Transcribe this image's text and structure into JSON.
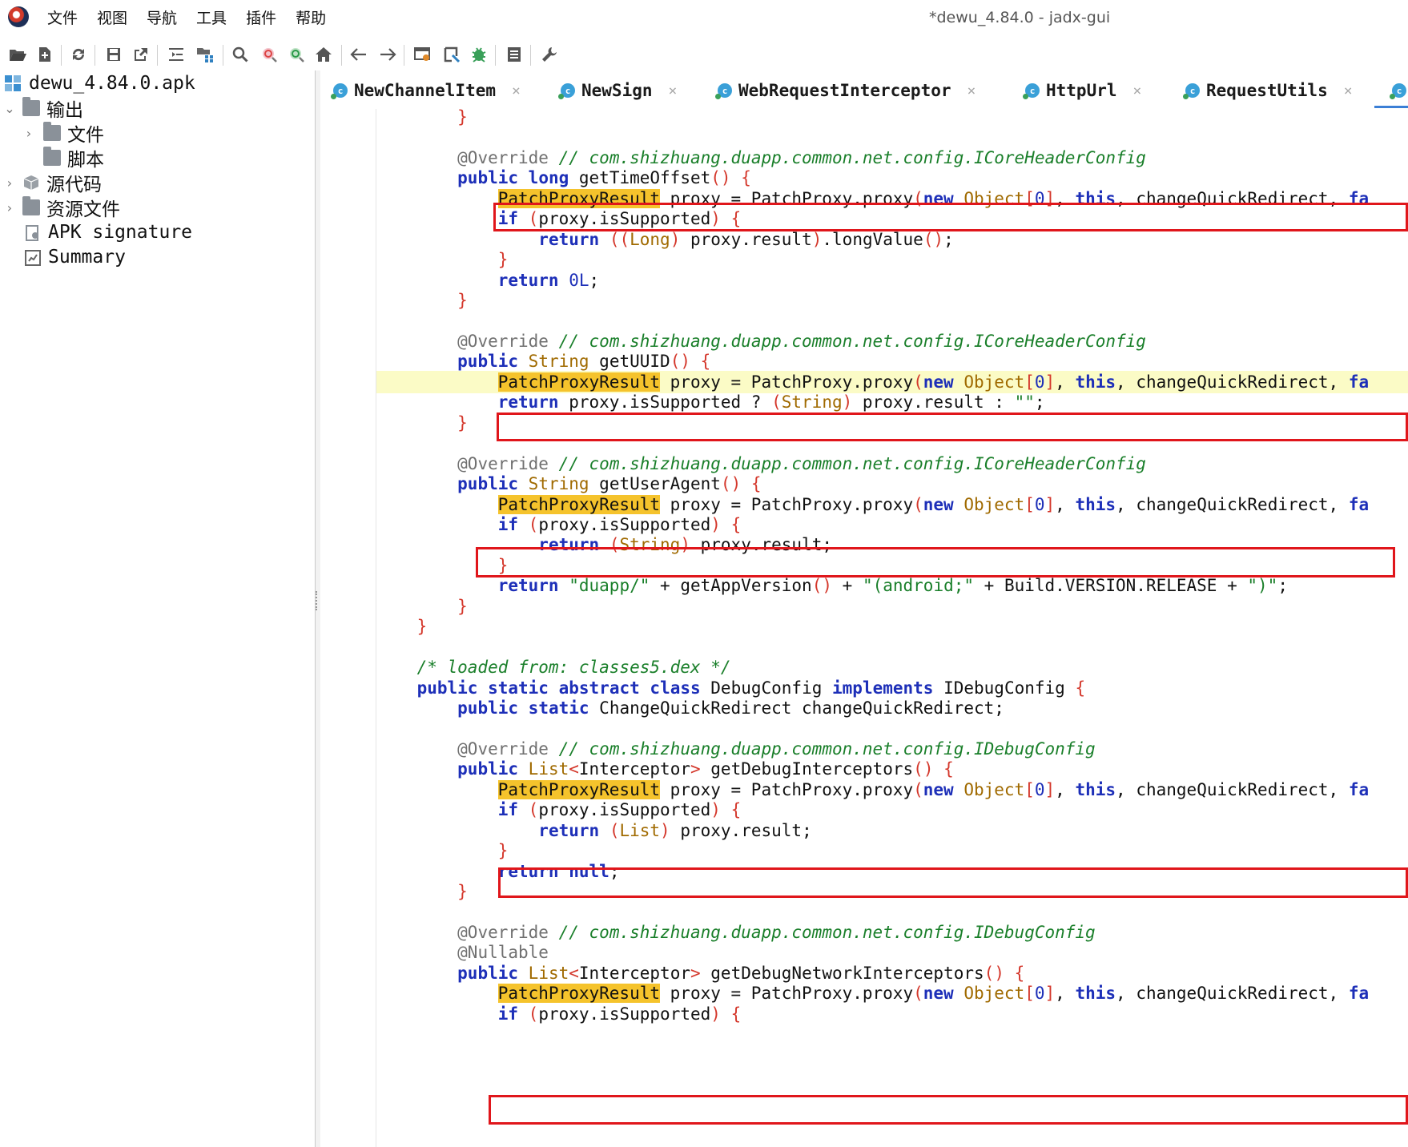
{
  "window": {
    "title": "*dewu_4.84.0 - jadx-gui",
    "menu": [
      "文件",
      "视图",
      "导航",
      "工具",
      "插件",
      "帮助"
    ]
  },
  "toolbar": {
    "icons": [
      "open-file-icon",
      "add-file-icon",
      "sync-icon",
      "save-icon",
      "export-icon",
      "text-search-icon",
      "class-tree-icon",
      "search-icon",
      "find-class-icon",
      "find-usage-icon",
      "home-icon",
      "back-icon",
      "forward-icon",
      "quick-tabs-icon",
      "deobfuscation-icon",
      "debugger-icon",
      "log-icon",
      "settings-icon"
    ]
  },
  "tree": {
    "items": [
      {
        "label": "dewu_4.84.0.apk",
        "icon": "apk-icon"
      },
      {
        "label": "输出",
        "icon": "folder-icon",
        "expanded": true
      },
      {
        "label": "文件",
        "icon": "folder-icon"
      },
      {
        "label": "脚本",
        "icon": "folder-icon"
      },
      {
        "label": "源代码",
        "icon": "package-icon"
      },
      {
        "label": "资源文件",
        "icon": "folder-icon"
      },
      {
        "label": "APK signature",
        "icon": "signature-icon"
      },
      {
        "label": "Summary",
        "icon": "summary-icon"
      }
    ]
  },
  "tabs": [
    {
      "label": "NewChannelItem"
    },
    {
      "label": "NewSign"
    },
    {
      "label": "WebRequestInterceptor"
    },
    {
      "label": "HttpUrl"
    },
    {
      "label": "RequestUtils"
    }
  ],
  "code_lines": [
    "        }",
    "",
    "        @Override // com.shizhuang.duapp.common.net.config.ICoreHeaderConfig",
    "        public long getTimeOffset() {",
    "            PatchProxyResult proxy = PatchProxy.proxy(new Object[0], this, changeQuickRedirect, fa",
    "            if (proxy.isSupported) {",
    "                return ((Long) proxy.result).longValue();",
    "            }",
    "            return 0L;",
    "        }",
    "",
    "        @Override // com.shizhuang.duapp.common.net.config.ICoreHeaderConfig",
    "        public String getUUID() {",
    "            PatchProxyResult proxy = PatchProxy.proxy(new Object[0], this, changeQuickRedirect, fa",
    "            return proxy.isSupported ? (String) proxy.result : \"\";",
    "        }",
    "",
    "        @Override // com.shizhuang.duapp.common.net.config.ICoreHeaderConfig",
    "        public String getUserAgent() {",
    "            PatchProxyResult proxy = PatchProxy.proxy(new Object[0], this, changeQuickRedirect, fa",
    "            if (proxy.isSupported) {",
    "                return (String) proxy.result;",
    "            }",
    "            return \"duapp/\" + getAppVersion() + \"(android;\" + Build.VERSION.RELEASE + \")\";",
    "        }",
    "    }",
    "",
    "    /* loaded from: classes5.dex */",
    "    public static abstract class DebugConfig implements IDebugConfig {",
    "        public static ChangeQuickRedirect changeQuickRedirect;",
    "",
    "        @Override // com.shizhuang.duapp.common.net.config.IDebugConfig",
    "        public List<Interceptor> getDebugInterceptors() {",
    "            PatchProxyResult proxy = PatchProxy.proxy(new Object[0], this, changeQuickRedirect, fa",
    "            if (proxy.isSupported) {",
    "                return (List) proxy.result;",
    "            }",
    "            return null;",
    "        }",
    "",
    "        @Override // com.shizhuang.duapp.common.net.config.IDebugConfig",
    "        @Nullable",
    "        public List<Interceptor> getDebugNetworkInterceptors() {",
    "            PatchProxyResult proxy = PatchProxy.proxy(new Object[0], this, changeQuickRedirect, fa",
    "            if (proxy.isSupported) {"
  ],
  "highlighted_line_index": 13,
  "search_highlight": "PatchProxyResult"
}
